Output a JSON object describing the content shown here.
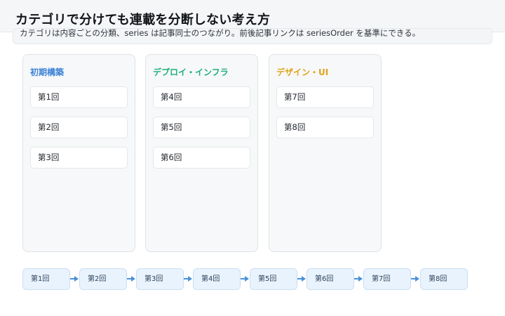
{
  "header": {
    "title": "カテゴリで分けても連載を分断しない考え方",
    "subtitle": "カテゴリは内容ごとの分類、series は記事同士のつながり。前後記事リンクは seriesOrder を基準にできる。"
  },
  "colors": {
    "category_1": "#3b82d6",
    "category_2": "#1fb07a",
    "category_3": "#e0a31a",
    "arrow": "#4a90d9"
  },
  "categories": [
    {
      "name": "初期構築",
      "items": [
        "第1回",
        "第2回",
        "第3回"
      ]
    },
    {
      "name": "デプロイ・インフラ",
      "items": [
        "第4回",
        "第5回",
        "第6回"
      ]
    },
    {
      "name": "デザイン・UI",
      "items": [
        "第7回",
        "第8回"
      ]
    }
  ],
  "series_order": [
    "第1回",
    "第2回",
    "第3回",
    "第4回",
    "第5回",
    "第6回",
    "第7回",
    "第8回"
  ]
}
